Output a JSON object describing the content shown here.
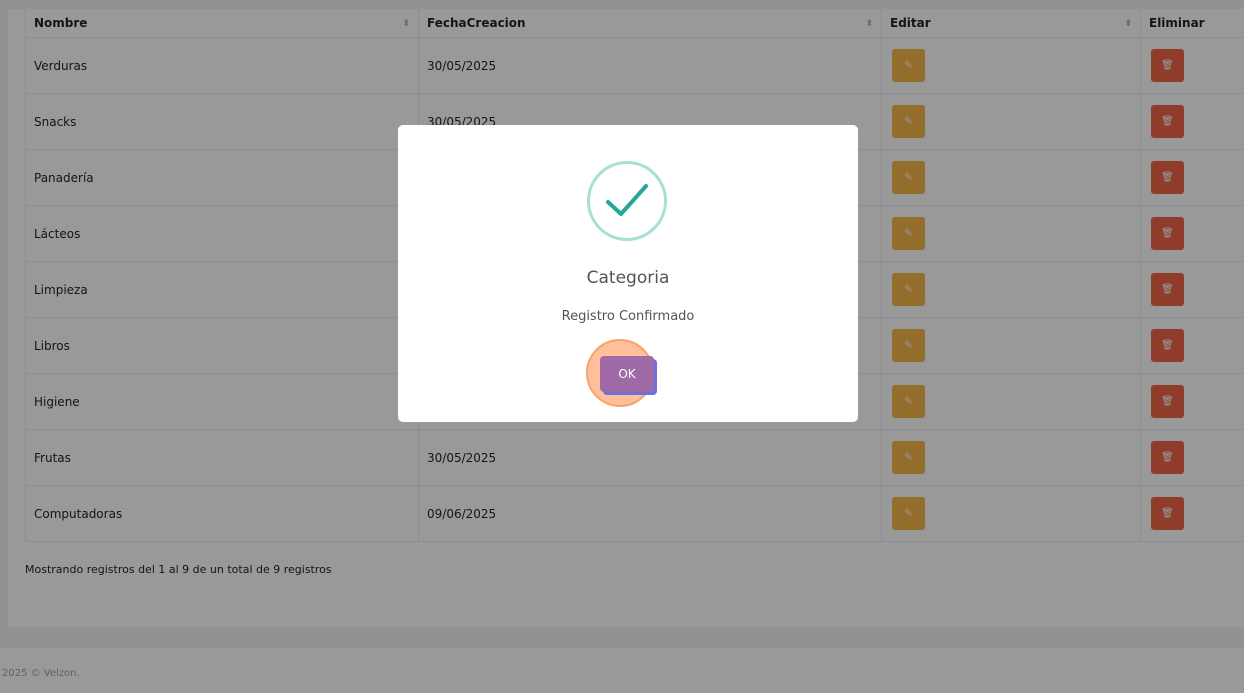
{
  "table": {
    "columns": [
      "Nombre",
      "FechaCreacion",
      "Editar",
      "Eliminar"
    ],
    "rows": [
      {
        "nombre": "Verduras",
        "fecha": "30/05/2025"
      },
      {
        "nombre": "Snacks",
        "fecha": "30/05/2025"
      },
      {
        "nombre": "Panadería",
        "fecha": ""
      },
      {
        "nombre": "Lácteos",
        "fecha": ""
      },
      {
        "nombre": "Limpieza",
        "fecha": ""
      },
      {
        "nombre": "Libros",
        "fecha": ""
      },
      {
        "nombre": "Higiene",
        "fecha": ""
      },
      {
        "nombre": "Frutas",
        "fecha": "30/05/2025"
      },
      {
        "nombre": "Computadoras",
        "fecha": "09/06/2025"
      }
    ],
    "sort_icon": "⬍",
    "edit_icon": "pencil-icon",
    "delete_icon": "trash-icon"
  },
  "info_text": "Mostrando registros del 1 al 9 de un total de 9 registros",
  "footer_text": "2025 © Velzon.",
  "modal": {
    "title": "Categoria",
    "text": "Registro Confirmado",
    "ok_label": "OK",
    "icon": "success-check-icon"
  },
  "colors": {
    "edit": "#f7b84b",
    "delete": "#f06548",
    "ok_button": "#a06aa6",
    "success": "#a5dfd5"
  }
}
